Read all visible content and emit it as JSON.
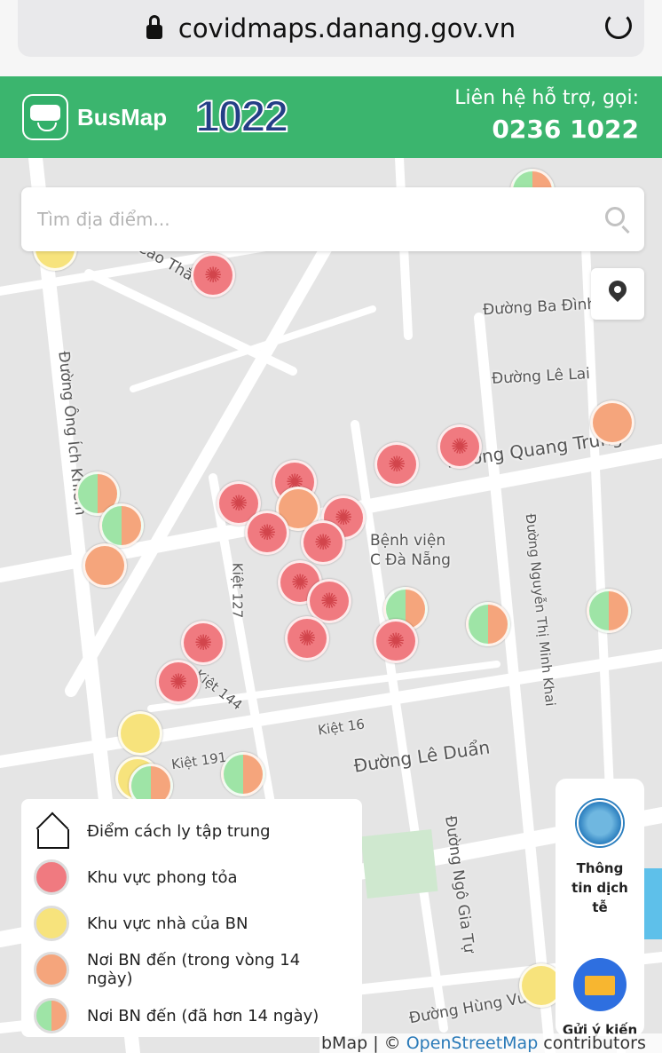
{
  "browser": {
    "url": "covidmaps.danang.gov.vn"
  },
  "header": {
    "brand": "BusMap",
    "hotline_logo": "1022",
    "contact_label": "Liên hệ hỗ trợ, gọi:",
    "contact_phone": "0236 1022"
  },
  "search": {
    "placeholder": "Tìm địa điểm..."
  },
  "streets": [
    "Đường Ba Đình",
    "Đường Lê Lai",
    "Đường Quang Trung",
    "Bệnh viện C Đà Nẵng",
    "Kiệt 127",
    "Kiệt 144",
    "Kiệt 16",
    "Kiệt 191",
    "Đường Lê Duẩn",
    "Đường Ngô Gia Tự",
    "Đường Nguyễn Thị Minh Khai",
    "Đường Ông Ích Khiêm",
    "Cao Thắng",
    "Đường Hùng Vương"
  ],
  "legend": [
    {
      "icon": "home-icon",
      "label": "Điểm cách ly tập trung"
    },
    {
      "icon": "virus-icon",
      "label": "Khu vực phong tỏa",
      "color": "#f07a80"
    },
    {
      "icon": "yellow-circle",
      "label": "Khu vực nhà của BN",
      "color": "#f7e37c"
    },
    {
      "icon": "orange-circle",
      "label": "Nơi BN đến (trong vòng 14 ngày)",
      "color": "#f5a57c"
    },
    {
      "icon": "split-circle",
      "label": "Nơi BN đến (đã hơn 14 ngày)",
      "color": "#9ee4a6"
    }
  ],
  "side_panel": {
    "info_label": "Thông tin dịch tễ",
    "feedback_label": "Gửi ý kiến"
  },
  "attribution": {
    "prefix": "bMap | © ",
    "link": "OpenStreetMap",
    "suffix": " contributors"
  },
  "colors": {
    "header": "#3bb56e",
    "lockdown": "#f07a80",
    "home": "#f7e37c",
    "recent": "#f5a57c",
    "old": "#9ee4a6"
  }
}
